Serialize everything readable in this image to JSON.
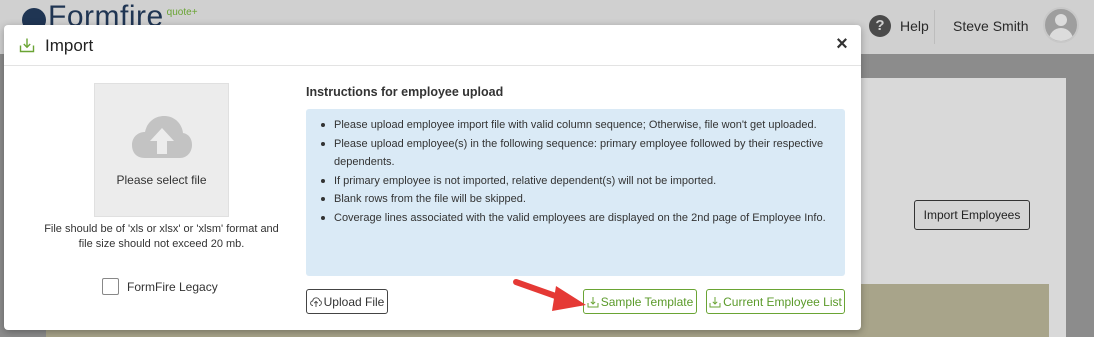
{
  "app": {
    "logo_text": "Formfire",
    "logo_sub": "quote+",
    "help_label": "Help",
    "user_name": "Steve Smith"
  },
  "background": {
    "import_employees_label": "Import Employees"
  },
  "modal": {
    "title": "Import",
    "close_label": "×",
    "dropzone_label": "Please select file",
    "file_note": "File should be of 'xls or xlsx' or 'xlsm' format and file size should not exceed 20 mb.",
    "legacy_label": "FormFire Legacy",
    "legacy_checked": false,
    "instructions_title": "Instructions for employee upload",
    "instructions": [
      "Please upload employee import file with valid column sequence; Otherwise, file won't get uploaded.",
      "Please upload employee(s) in the following sequence: primary employee followed by their respective dependents.",
      "If primary employee is not imported, relative dependent(s) will not be imported.",
      "Blank rows from the file will be skipped.",
      "Coverage lines associated with the valid employees are displayed on the 2nd page of Employee Info."
    ],
    "buttons": {
      "upload_label": "Upload File",
      "sample_label": "Sample Template",
      "current_label": "Current Employee List"
    }
  },
  "icons": {
    "import": "import-icon",
    "upload": "upload-icon",
    "download": "download-icon",
    "cloud": "cloud-upload-icon",
    "help": "help-icon",
    "close": "close-icon",
    "avatar": "avatar-icon"
  },
  "colors": {
    "accent_green": "#6aa434",
    "instructions_bg": "#daeaf6",
    "annotation_arrow": "#e53935",
    "logo_navy": "#1f3553"
  }
}
